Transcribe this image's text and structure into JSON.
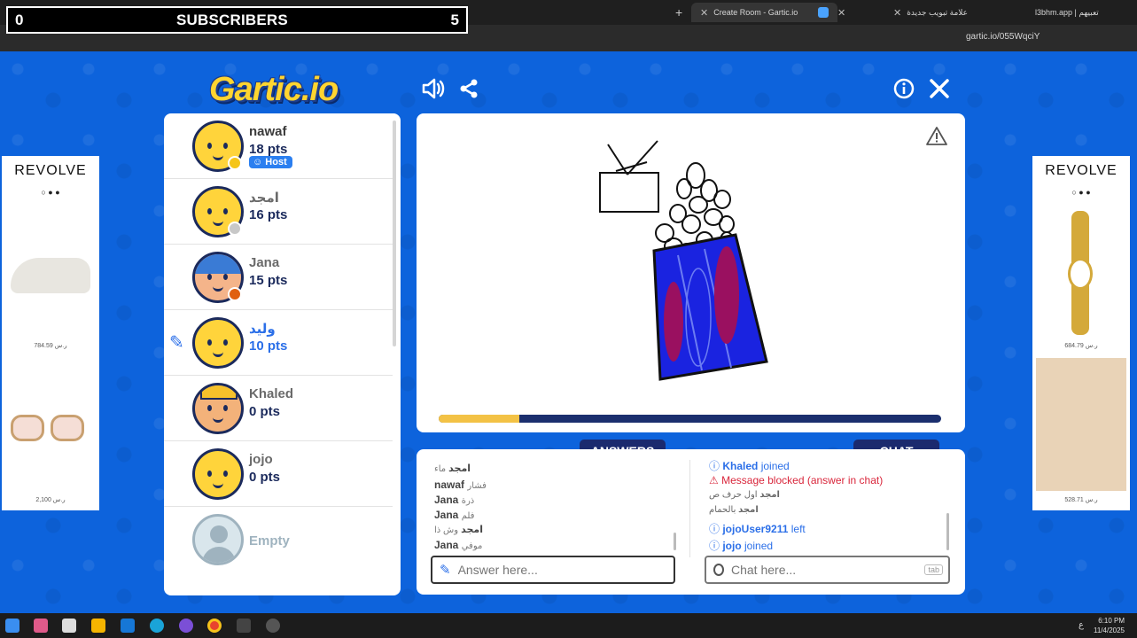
{
  "subscriber_overlay": {
    "left_count": "0",
    "label": "SUBSCRIBERS",
    "right_count": "5"
  },
  "browser": {
    "tabs": [
      {
        "title": "Create Room - Gartic.io",
        "active": true
      },
      {
        "title": "علامة تبويب جديدة",
        "active": false
      },
      {
        "title": "l3bhm.app | تعبيهم",
        "active": false
      }
    ],
    "url": "gartic.io/055WqciY"
  },
  "game": {
    "logo": "Gartic.io",
    "players": [
      {
        "name": "nawaf",
        "pts": "18 pts",
        "badge": "Host",
        "status_color": "#f5c518"
      },
      {
        "name": "امجد",
        "pts": "16 pts",
        "status_color": "#c8c8c8"
      },
      {
        "name": "Jana",
        "pts": "15 pts",
        "status_color": "#e06010"
      },
      {
        "name": "وليد",
        "pts": "10 pts",
        "drawing": true
      },
      {
        "name": "Khaled",
        "pts": "0 pts"
      },
      {
        "name": "jojo",
        "pts": "0 pts"
      },
      {
        "name": "Empty",
        "pts": ""
      }
    ],
    "timer_fraction": 0.16,
    "answers_tab": "ANSWERS",
    "chat_tab": "CHAT",
    "answers": [
      {
        "user": "امجد",
        "text": "ماء"
      },
      {
        "user": "nawaf",
        "text": "فشار"
      },
      {
        "user": "Jana",
        "text": "ذرة"
      },
      {
        "user": "Jana",
        "text": "فلم"
      },
      {
        "user": "امجد",
        "text": "وش ذا"
      },
      {
        "user": "Jana",
        "text": "موفي"
      }
    ],
    "chat": [
      {
        "type": "info",
        "user": "Khaled",
        "text": "joined"
      },
      {
        "type": "warning",
        "user": "",
        "text": "Message blocked (answer in chat)"
      },
      {
        "type": "msg",
        "user": "امجد",
        "text": "اول حرف ص"
      },
      {
        "type": "msg",
        "user": "امجد",
        "text": "بالحمام"
      },
      {
        "type": "info",
        "user": "jojoUser9211",
        "text": "left"
      },
      {
        "type": "info",
        "user": "jojo",
        "text": "joined"
      }
    ],
    "answer_placeholder": "Answer here...",
    "chat_placeholder": "Chat here...",
    "chat_shortcut": "tab"
  },
  "ads": {
    "left": {
      "brand": "REVOLVE",
      "prices": [
        "784.59 ر.س",
        "2,100 ر.س"
      ]
    },
    "right": {
      "brand": "REVOLVE",
      "prices": [
        "684.79 ر.س",
        "528.71 ر.س"
      ]
    }
  },
  "taskbar": {
    "time": "6:10 PM",
    "date": "11/4/2025",
    "lang": "ع"
  }
}
